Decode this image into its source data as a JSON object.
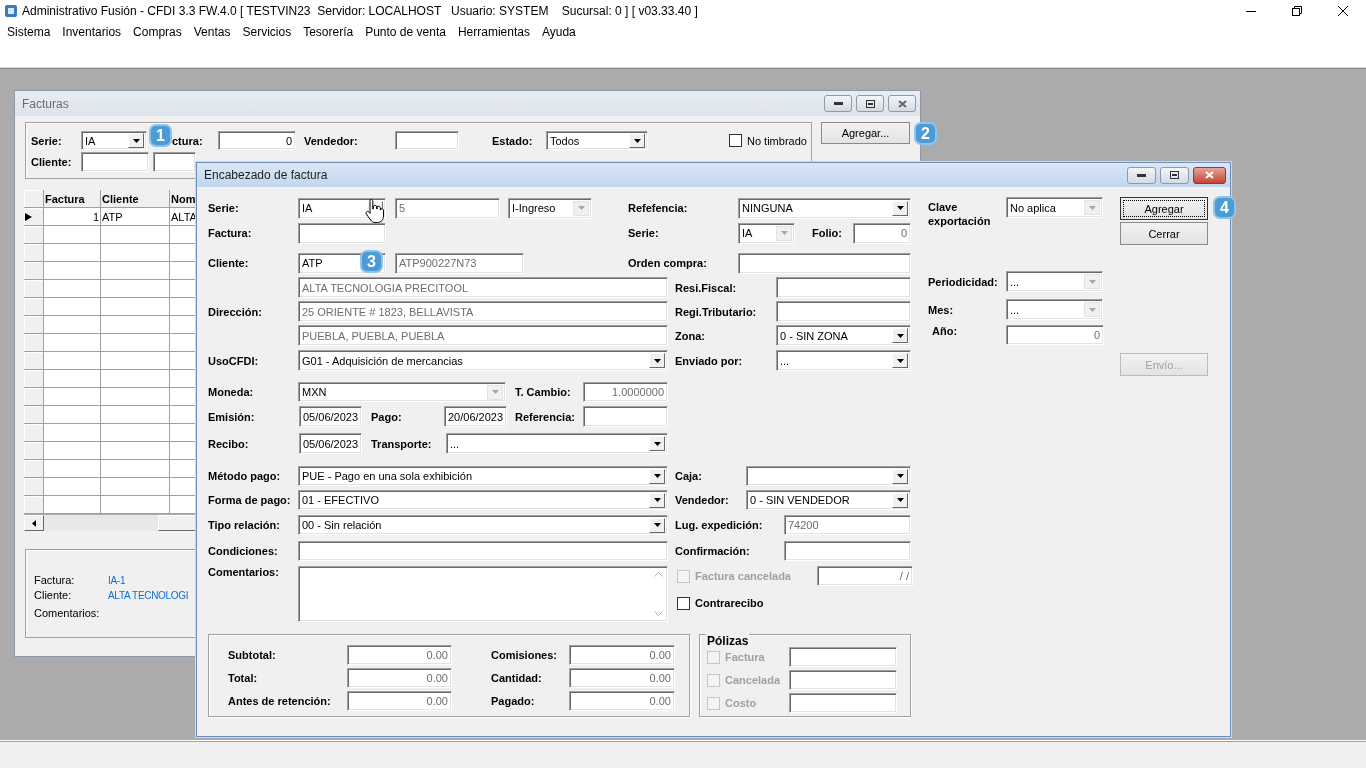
{
  "app": {
    "title": "Administrativo Fusión - CFDI 3.3 FW.4.0 [ TESTVIN23  Servidor: LOCALHOST   Usuario: SYSTEM    Sucursal: 0 ] [ v03.33.40 ]",
    "menu": [
      "Sistema",
      "Inventarios",
      "Compras",
      "Ventas",
      "Servicios",
      "Tesorería",
      "Punto de venta",
      "Herramientas",
      "Ayuda"
    ]
  },
  "facturas": {
    "title": "Facturas",
    "serie": {
      "label": "Serie:",
      "value": "IA"
    },
    "factura": {
      "label": "ctura:",
      "value": "0"
    },
    "vendedor": {
      "label": "Vendedor:"
    },
    "estado": {
      "label": "Estado:",
      "value": "Todos"
    },
    "no_timbrado": {
      "label": "No timbrado",
      "checked": false
    },
    "agregar": "Agregar...",
    "cliente": {
      "label": "Cliente:"
    },
    "table": {
      "columns": [
        "Factura",
        "Cliente",
        "Nom"
      ],
      "rows": [
        {
          "cells": [
            "1",
            "ATP",
            "ALTA"
          ],
          "current": true
        }
      ]
    },
    "details": [
      {
        "label": "Factura:",
        "value": "IA-1"
      },
      {
        "label": "Cliente:",
        "value": "ALTA TECNOLOGI"
      },
      {
        "label": "Comentarios:"
      }
    ]
  },
  "dialog": {
    "title": "Encabezado de factura",
    "serie": {
      "label": "Serie:",
      "value": "IA"
    },
    "consecutivo": {
      "value": "5",
      "disabled": true
    },
    "tipo": {
      "value": "I-Ingreso",
      "disabled": true
    },
    "referencia": {
      "label": "Refefencia:",
      "value": "NINGUNA"
    },
    "factura": {
      "label": "Factura:"
    },
    "serie_ref": {
      "label": "Serie:",
      "value": "IA",
      "disabled": true
    },
    "folio": {
      "label": "Folio:",
      "value": "0",
      "disabled": true
    },
    "cliente": {
      "label": "Cliente:",
      "value": "ATP"
    },
    "rfc": {
      "value": "ATP900227N73",
      "disabled": true
    },
    "orden_compra": {
      "label": "Orden compra:"
    },
    "direccion": {
      "label": "Dirección:",
      "lines": [
        "ALTA TECNOLOGIA PRECITOOL",
        "25 ORIENTE # 1823, BELLAVISTA",
        "PUEBLA, PUEBLA, PUEBLA"
      ]
    },
    "resi_fiscal": {
      "label": "Resi.Fiscal:"
    },
    "regi_tributario": {
      "label": "Regi.Tributario:"
    },
    "zona": {
      "label": "Zona:",
      "value": "0 - SIN ZONA"
    },
    "uso_cfdi": {
      "label": "UsoCFDI:",
      "value": "G01 - Adquisición de mercancias"
    },
    "enviado_por": {
      "label": "Enviado por:",
      "value": "..."
    },
    "clave_exportacion": {
      "label": "Clave exportación",
      "value": "No aplica",
      "disabled": true
    },
    "periodicidad": {
      "label": "Periodicidad:",
      "value": "...",
      "disabled": true
    },
    "mes": {
      "label": "Mes:",
      "value": "...",
      "disabled": true
    },
    "anio": {
      "label": "Año:",
      "value": "0",
      "disabled": true
    },
    "buttons": [
      {
        "label": "Agregar",
        "focused": true,
        "disabled": false
      },
      {
        "label": "Cerrar",
        "focused": false,
        "disabled": false
      },
      {
        "label": "Envío...",
        "focused": false,
        "disabled": true
      }
    ],
    "moneda": {
      "label": "Moneda:",
      "value": "MXN",
      "disabled": true
    },
    "tipo_cambio": {
      "label": "T. Cambio:",
      "value": "1.0000000",
      "disabled": true
    },
    "emision": {
      "label": "Emisión:",
      "value": "05/06/2023"
    },
    "pago": {
      "label": "Pago:",
      "value": "20/06/2023"
    },
    "referencia_pago": {
      "label": "Referencia:"
    },
    "recibo": {
      "label": "Recibo:",
      "value": "05/06/2023"
    },
    "transporte": {
      "label": "Transporte:",
      "value": "..."
    },
    "metodo_pago": {
      "label": "Método pago:",
      "value": "PUE - Pago en una sola exhibición"
    },
    "caja": {
      "label": "Caja:"
    },
    "forma_pago": {
      "label": "Forma de pago:",
      "value": "01 - EFECTIVO"
    },
    "vendedor": {
      "label": "Vendedor:",
      "value": "0 - SIN VENDEDOR"
    },
    "tipo_relacion": {
      "label": "Tipo relación:",
      "value": "00 - Sin relación"
    },
    "lugar_expedicion": {
      "label": "Lug. expedición:",
      "value": "74200",
      "disabled": true
    },
    "condiciones": {
      "label": "Condiciones:"
    },
    "confirmacion": {
      "label": "Confirmación:"
    },
    "comentarios": {
      "label": "Comentarios:"
    },
    "factura_cancelada": {
      "label": "Factura cancelada",
      "checked": false,
      "disabled": true,
      "date": "/ /"
    },
    "contrarecibo": {
      "label": "Contrarecibo",
      "checked": false,
      "disabled": false
    },
    "totals": [
      {
        "label": "Subtotal:",
        "value": "0.00",
        "disabled": true
      },
      {
        "label": "Comisiones:",
        "value": "0.00",
        "disabled": true
      },
      {
        "label": "Total:",
        "value": "0.00",
        "disabled": true
      },
      {
        "label": "Cantidad:",
        "value": "0.00",
        "disabled": true
      },
      {
        "label": "Antes de retención:",
        "value": "0.00",
        "disabled": true
      },
      {
        "label": "Pagado:",
        "value": "0.00",
        "disabled": true
      }
    ],
    "polizas": {
      "title": "Pólizas",
      "items": [
        {
          "label": "Factura",
          "checked": false,
          "disabled": true
        },
        {
          "label": "Cancelada",
          "checked": false,
          "disabled": true
        },
        {
          "label": "Costo",
          "checked": false,
          "disabled": true
        }
      ]
    }
  },
  "badges": [
    "1",
    "2",
    "3",
    "4"
  ]
}
